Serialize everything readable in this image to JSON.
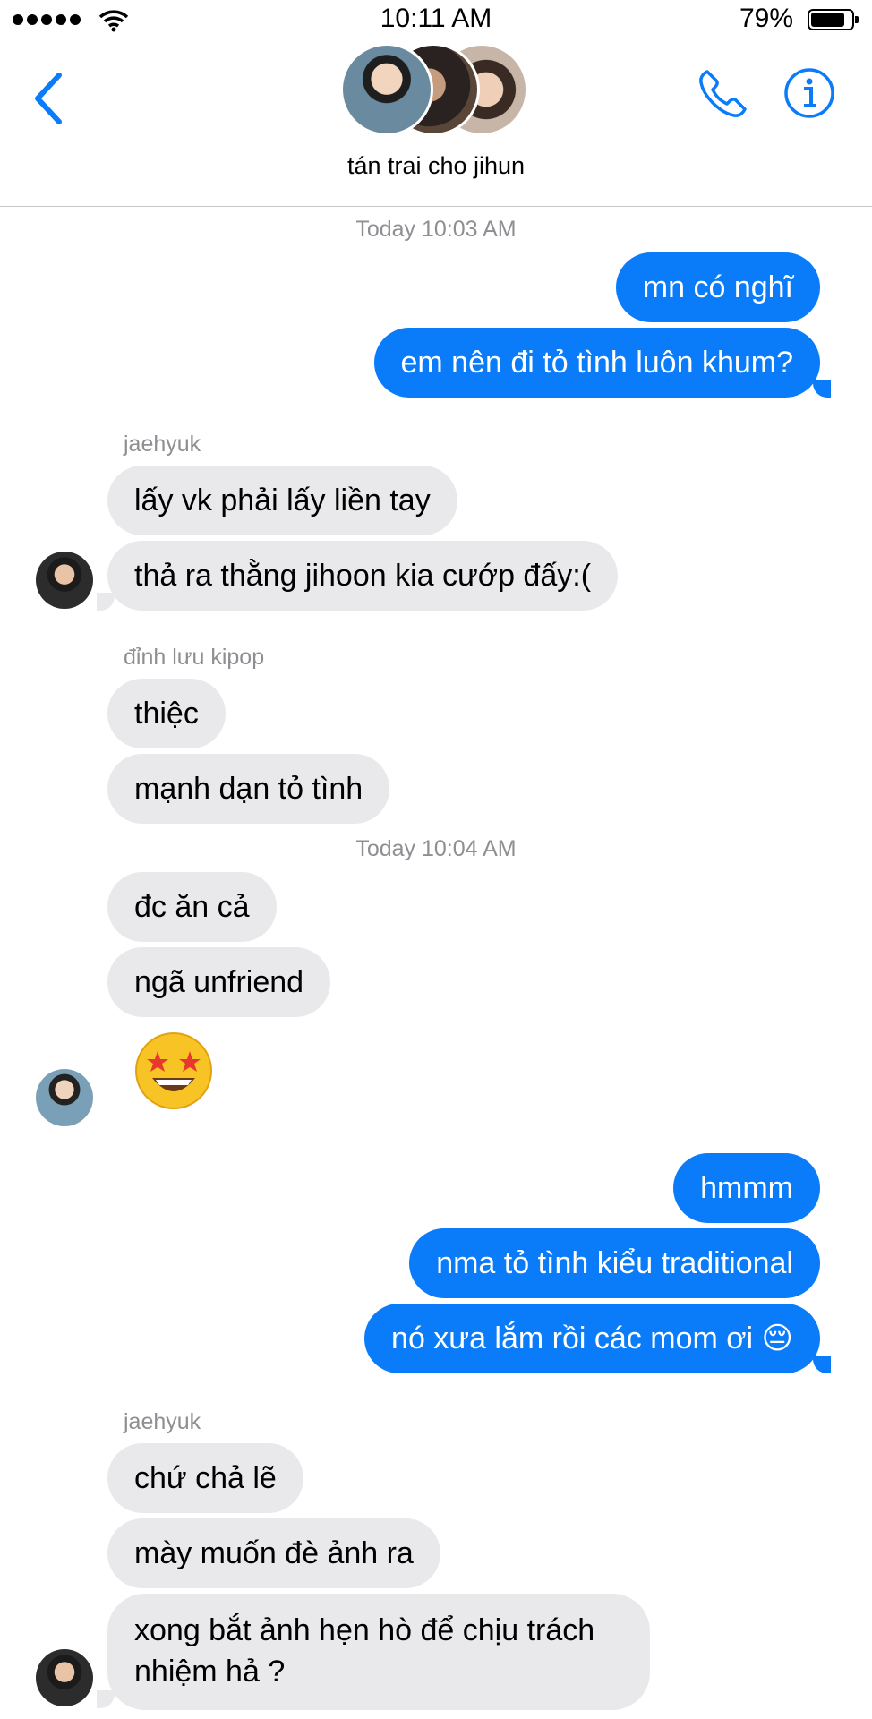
{
  "status_bar": {
    "time": "10:11 AM",
    "battery": "79%",
    "battery_level": 0.79
  },
  "nav": {
    "title": "tán trai cho jihun",
    "icons": [
      "back-chevron-icon",
      "phone-icon",
      "info-icon"
    ]
  },
  "colors": {
    "accent": "#0a7cf9",
    "incoming_bubble": "#e9e9eb",
    "meta_text": "#8e8e93"
  },
  "messages": {
    "ts1": "Today 10:03 AM",
    "m1": "mn có nghĩ",
    "m2": "em nên đi tỏ tình luôn khum?",
    "sender1": "jaehyuk",
    "m3": "lấy vk phải lấy liền tay",
    "m4": "thả ra thằng jihoon kia cướp đấy:(",
    "sender2": "đỉnh lưu kipop",
    "m5": "thiệc",
    "m6": "mạnh dạn tỏ tình",
    "ts2": "Today 10:04 AM",
    "m7": "đc ăn cả",
    "m8": "ngã unfriend",
    "m9_emoji": "star-struck-emoji",
    "m10": "hmmm",
    "m11": "nma tỏ tình kiểu traditional",
    "m12": "nó xưa lắm rồi các mom ơi 😔",
    "sender3": "jaehyuk",
    "m13": "chứ chả lẽ",
    "m14": "mày muốn đè ảnh ra",
    "m15": "xong bắt ảnh hẹn hò để chịu trách nhiệm hả ?"
  }
}
